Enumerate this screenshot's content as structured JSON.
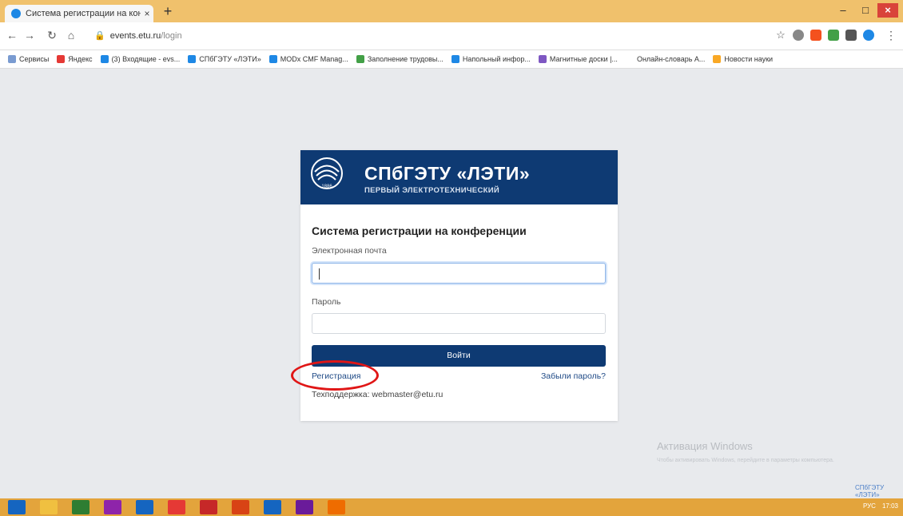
{
  "browser": {
    "tab_title": "Система регистрации на конф",
    "tab_close": "×",
    "new_tab": "+",
    "url_domain": "events.etu.ru",
    "url_path": "/login",
    "window_controls": {
      "minimize": "–",
      "maximize": "□",
      "close": "×"
    },
    "nav_icons": [
      "back-icon",
      "forward-icon",
      "reload-icon",
      "home-icon"
    ],
    "bookmarks": [
      {
        "label": "Сервисы",
        "color": "#7a9bd1"
      },
      {
        "label": "Яндекс",
        "color": "#e53935"
      },
      {
        "label": "(3) Входящие - evs...",
        "color": "#1e88e5"
      },
      {
        "label": "СПбГЭТУ «ЛЭТИ»",
        "color": "#1e88e5"
      },
      {
        "label": "MODx CMF Manag...",
        "color": "#1e88e5"
      },
      {
        "label": "Заполнение трудовы...",
        "color": "#43a047"
      },
      {
        "label": "Напольный инфор...",
        "color": "#1e88e5"
      },
      {
        "label": "Магнитные доски |...",
        "color": "#7e57c2"
      },
      {
        "label": "Онлайн-словарь А...",
        "color": "#ffffff"
      },
      {
        "label": "Новости науки",
        "color": "#f9a825"
      }
    ]
  },
  "brand": {
    "name": "СПбГЭТУ «ЛЭТИ»",
    "subtitle": "ПЕРВЫЙ ЭЛЕКТРОТЕХНИЧЕСКИЙ",
    "emblem_year": "1886",
    "color": "#0e3a73"
  },
  "login": {
    "title": "Система регистрации на конференции",
    "email_label": "Электронная почта",
    "email_value": "",
    "password_label": "Пароль",
    "password_value": "",
    "submit_label": "Войти",
    "register_link": "Регистрация",
    "forgot_link": "Забыли пароль?",
    "support_text": "Техподдержка: webmaster@etu.ru"
  },
  "watermark": {
    "title": "Активация Windows",
    "text": "Чтобы активировать Windows, перейдите в параметры компьютера.",
    "corner_link": "СПбГЭТУ «ЛЭТИ»"
  },
  "taskbar": {
    "icons": [
      "windows-start-icon",
      "file-explorer-icon",
      "app-icon",
      "app-icon",
      "app-icon",
      "chrome-icon",
      "acrobat-icon",
      "powerpoint-icon",
      "word-icon",
      "app-icon",
      "firefox-icon"
    ],
    "tray_lang": "РУС",
    "tray_time": "17:03"
  }
}
